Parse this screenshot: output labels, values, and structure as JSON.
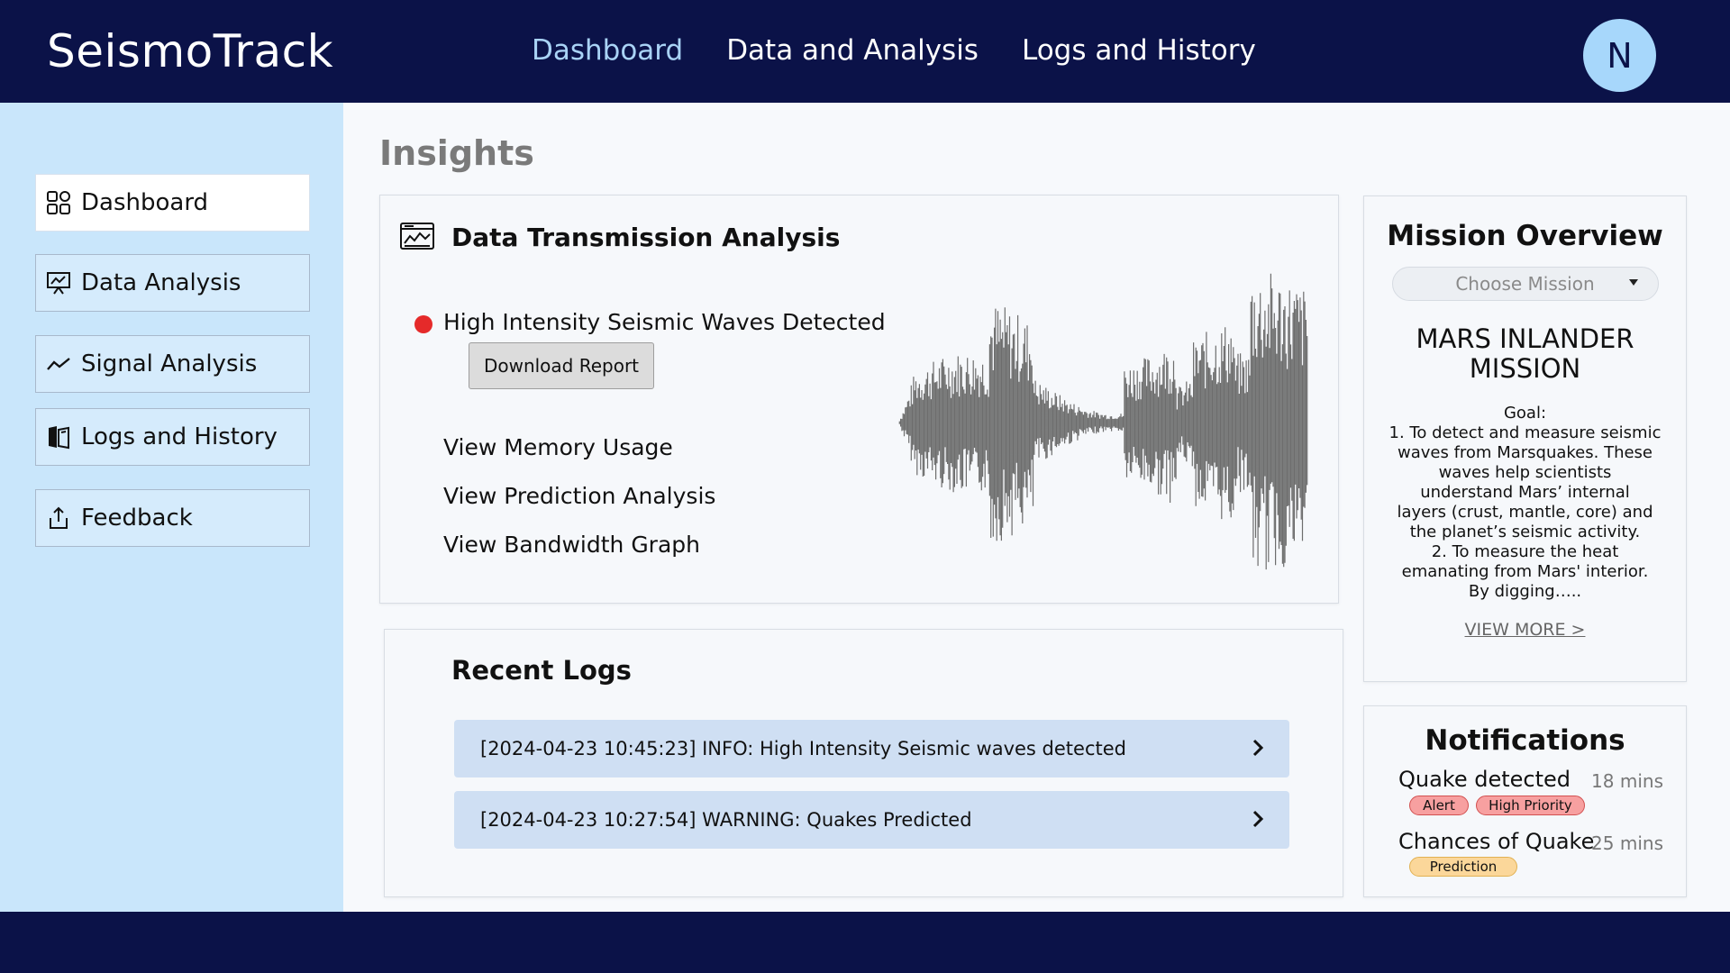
{
  "app": {
    "brand": "SeismoTrack"
  },
  "topnav": {
    "items": [
      {
        "label": "Dashboard",
        "active": true
      },
      {
        "label": "Data and Analysis"
      },
      {
        "label": "Logs and History"
      }
    ],
    "avatar_initial": "N"
  },
  "sidebar": {
    "items": [
      {
        "label": "Dashboard",
        "icon": "dashboard-grid-icon",
        "active": true
      },
      {
        "label": "Data Analysis",
        "icon": "presentation-chart-icon"
      },
      {
        "label": "Signal Analysis",
        "icon": "trend-line-icon"
      },
      {
        "label": "Logs and History",
        "icon": "book-icon"
      },
      {
        "label": "Feedback",
        "icon": "share-upload-icon"
      }
    ]
  },
  "main": {
    "title": "Insights",
    "transmission": {
      "title": "Data Transmission Analysis",
      "icon": "signal-monitor-icon",
      "alert_text": "High Intensity Seismic Waves Detected",
      "alert_color": "#e52a2a",
      "download_label": "Download Report",
      "links": [
        "View Memory Usage",
        "View Prediction Analysis",
        "View Bandwidth Graph"
      ]
    },
    "recent_logs": {
      "title": "Recent Logs",
      "entries": [
        "[2024-04-23 10:45:23] INFO: High Intensity Seismic waves detected",
        "[2024-04-23 10:27:54] WARNING: Quakes Predicted"
      ]
    }
  },
  "mission": {
    "title": "Mission Overview",
    "select_placeholder": "Choose Mission",
    "name_line1": "MARS INLANDER",
    "name_line2": "MISSION",
    "goal_heading": "Goal:",
    "goal_lines": [
      "1. To detect and measure seismic",
      "waves from Marsquakes. These",
      "waves help scientists",
      "understand Mars’ internal",
      "layers (crust, mantle, core) and",
      "the planet’s seismic activity.",
      "2.  To measure the heat",
      "emanating from Mars' interior.",
      "By digging….."
    ],
    "view_more": "VIEW MORE >"
  },
  "notifications": {
    "title": "Notifications",
    "items": [
      {
        "name": "Quake detected",
        "time": "18 mins",
        "badges": [
          "Alert",
          "High Priority"
        ]
      },
      {
        "name": "Chances of Quake",
        "time": "25 mins",
        "badges": [
          "Prediction"
        ]
      }
    ]
  },
  "colors": {
    "navy": "#0b1248",
    "sidebar_bg": "#c9e6fb",
    "active_nav": "#a9d3f6",
    "log_row": "#cfdff3",
    "badge_red": "#f7a0a0",
    "badge_yellow": "#fbd79a"
  }
}
